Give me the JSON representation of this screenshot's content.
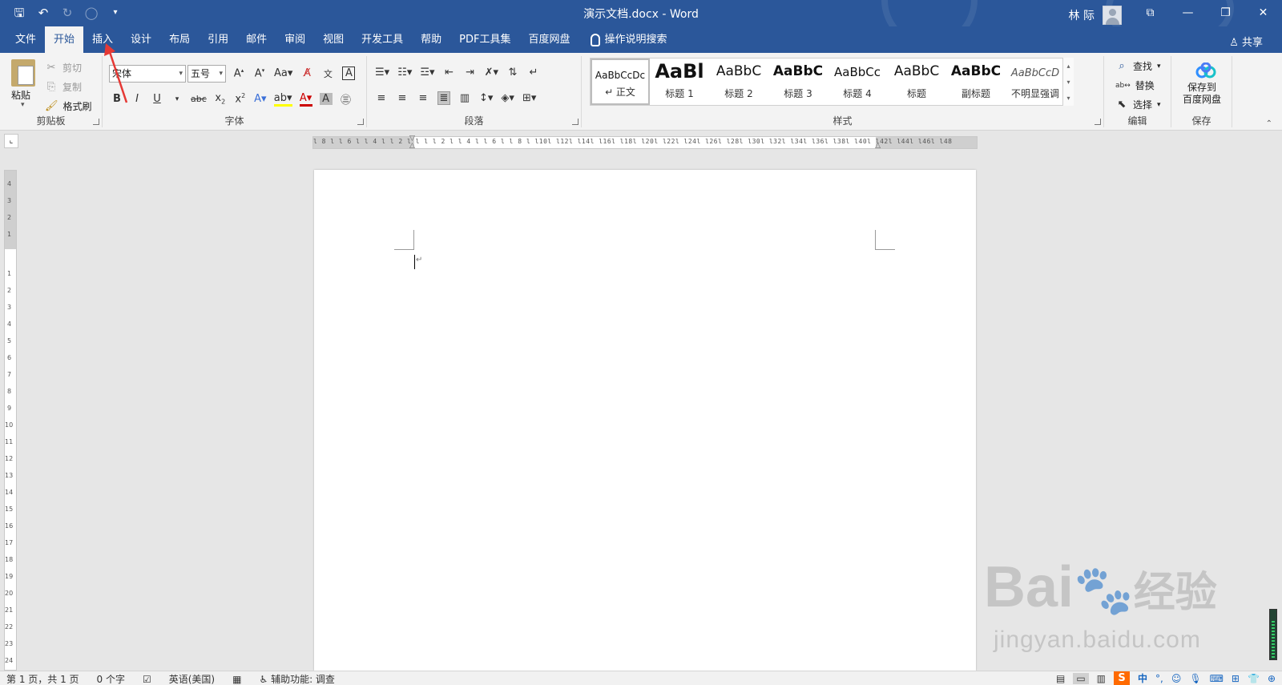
{
  "titlebar": {
    "title": "演示文档.docx - Word",
    "user_name": "林 际"
  },
  "tabs": [
    {
      "label": "文件"
    },
    {
      "label": "开始"
    },
    {
      "label": "插入"
    },
    {
      "label": "设计"
    },
    {
      "label": "布局"
    },
    {
      "label": "引用"
    },
    {
      "label": "邮件"
    },
    {
      "label": "审阅"
    },
    {
      "label": "视图"
    },
    {
      "label": "开发工具"
    },
    {
      "label": "帮助"
    },
    {
      "label": "PDF工具集"
    },
    {
      "label": "百度网盘"
    }
  ],
  "tellme": "操作说明搜索",
  "share": "共享",
  "clipboard": {
    "paste": "粘贴",
    "cut": "剪切",
    "copy": "复制",
    "format_painter": "格式刷",
    "label": "剪贴板"
  },
  "font": {
    "name": "宋体",
    "size": "五号",
    "label": "字体"
  },
  "paragraph": {
    "label": "段落"
  },
  "styles": {
    "label": "样式",
    "items": [
      {
        "sample": "AaBbCcDc",
        "name": "↵ 正文"
      },
      {
        "sample": "AaBl",
        "name": "标题 1"
      },
      {
        "sample": "AaBbC",
        "name": "标题 2"
      },
      {
        "sample": "AaBbC",
        "name": "标题 3"
      },
      {
        "sample": "AaBbCc",
        "name": "标题 4"
      },
      {
        "sample": "AaBbC",
        "name": "标题"
      },
      {
        "sample": "AaBbC",
        "name": "副标题"
      },
      {
        "sample": "AaBbCcD",
        "name": "不明显强调"
      }
    ]
  },
  "editing": {
    "find": "查找",
    "replace": "替换",
    "select": "选择",
    "label": "编辑"
  },
  "save": {
    "button": "保存到\n百度网盘",
    "label": "保存"
  },
  "ruler": {
    "horizontal_ticks": "l 8 l  l 6 l  l 4 l  l 2 l  l   l   l 2 l  l 4 l  l 6 l  l 8 l  l10l  l12l  l14l  l16l  l18l  l20l  l22l  l24l  l26l  l28l  l30l  l32l  l34l  l36l  l38l  l40l  l42l  l44l  l46l  l48",
    "vertical_top": [
      4,
      3,
      2,
      1
    ],
    "vertical_main": [
      1,
      2,
      3,
      4,
      5,
      6,
      7,
      8,
      9,
      10,
      11,
      12,
      13,
      14,
      15,
      16,
      17,
      18,
      19,
      20,
      21,
      22,
      23,
      24
    ]
  },
  "statusbar": {
    "page": "第 1 页，共 1 页",
    "words": "0 个字",
    "language": "英语(美国)",
    "accessibility": "辅助功能: 调查",
    "ime": "中",
    "ime_punct": "°,"
  },
  "watermark": {
    "brand": "Bai",
    "brand2": "经验",
    "url": "jingyan.baidu.com"
  }
}
